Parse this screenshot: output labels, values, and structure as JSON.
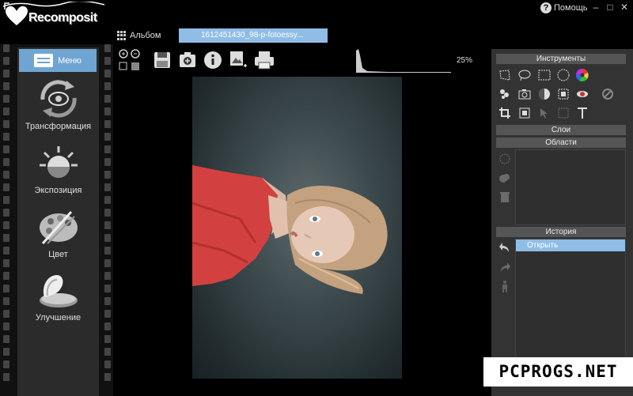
{
  "app": {
    "logo_text": "Recomposit"
  },
  "titlebar": {
    "help_label": "Помощь",
    "minimize": "–",
    "maximize": "□",
    "close": "✕"
  },
  "tabs": {
    "album_label": "Альбом",
    "file_tab": "1612451430_98-p-fotoessy..."
  },
  "sidebar": {
    "menu_label": "Меню",
    "items": [
      {
        "label": "Трансформация",
        "icon": "transform-icon"
      },
      {
        "label": "Экспозиция",
        "icon": "exposure-icon"
      },
      {
        "label": "Цвет",
        "icon": "color-palette-icon"
      },
      {
        "label": "Улучшение",
        "icon": "enhance-icon"
      }
    ]
  },
  "toolbar": {
    "zoom_percent": "25%"
  },
  "right_panel": {
    "tools_header": "Инструменты",
    "layers_header": "Слои",
    "areas_header": "Области",
    "history_header": "История",
    "history_items": [
      "Открыть"
    ]
  },
  "watermark": "PCPROGS.NET",
  "colors": {
    "accent": "#6fa5d2",
    "selection": "#8fbde6",
    "panel": "#333333",
    "sidebar": "#2b2b2b"
  }
}
